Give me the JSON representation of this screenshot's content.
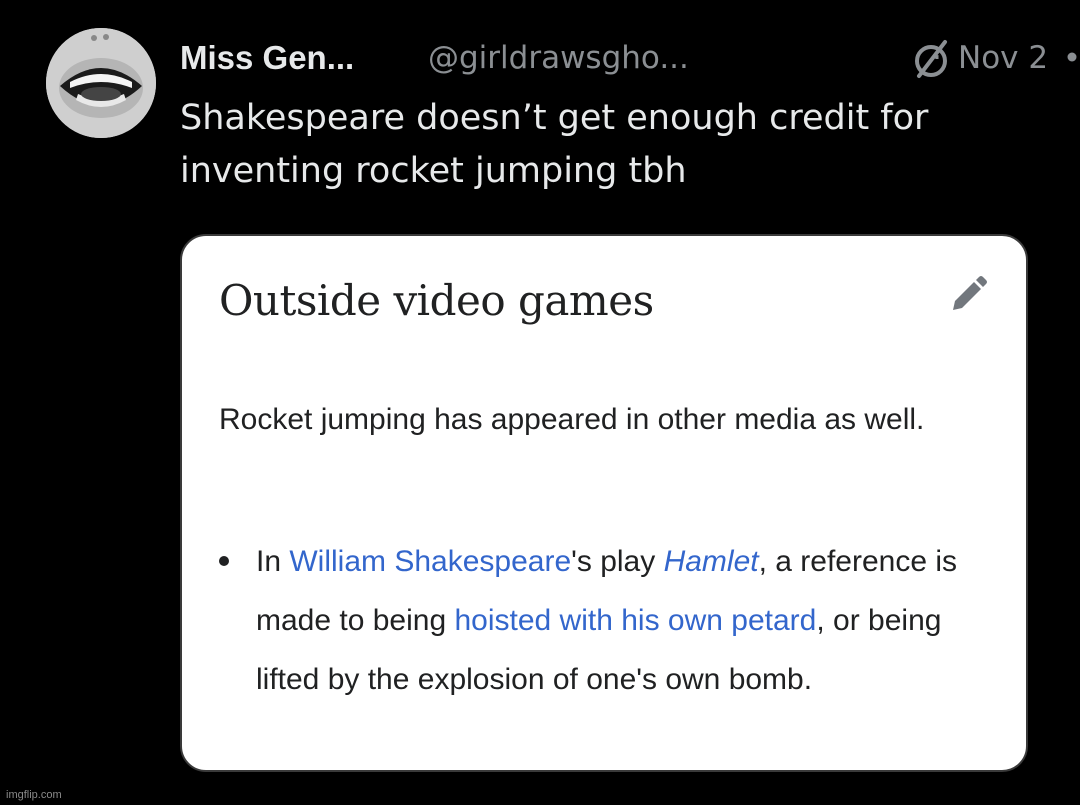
{
  "tweet": {
    "display_name": "Miss Gen...",
    "handle": "@girldrawsgho...",
    "separator": "·",
    "date": "Nov 2",
    "text": "Shakespeare doesn’t get enough credit for inventing rocket jumping tbh",
    "icons": {
      "avatar": "avatar-photo",
      "badge": "crossed-circle-icon",
      "more": "more-icon"
    }
  },
  "card": {
    "title": "Outside video games",
    "edit_icon": "pencil-icon",
    "intro": "Rocket jumping has appeared in other media as well.",
    "bullet": {
      "part1": "In ",
      "link1": "William Shakespeare",
      "part2": "'s play ",
      "link2": "Hamlet",
      "part3": ", a reference is made to being ",
      "link3": "hoisted with his own petard",
      "part4": ", or being lifted by the explosion of one's own bomb."
    }
  },
  "colors": {
    "background": "#000000",
    "text_primary": "#e7e9ea",
    "text_secondary": "#8b8f93",
    "link": "#3366cc"
  },
  "watermark": "imgflip.com"
}
